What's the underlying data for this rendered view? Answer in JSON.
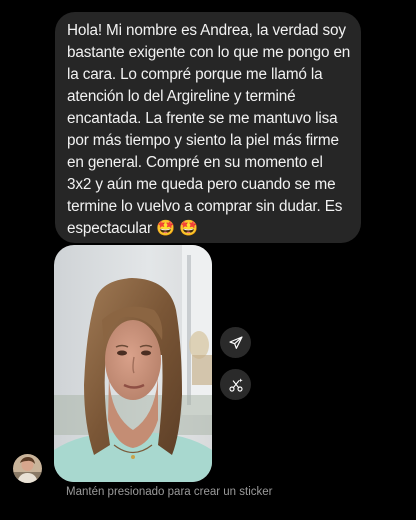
{
  "message": {
    "text": "Hola! Mi nombre es Andrea, la verdad soy bastante exigente con lo que me pongo en la cara. Lo compré porque me llamó la atención lo del Argireline y terminé encantada. La frente se me mantuvo lisa por más tiempo y siento la piel más firme en general. Compré en su momento el 3x2 y aún me queda pero cuando se me termine lo vuelvo a comprar sin dudar. Es espectacular 🤩 🤩"
  },
  "media": {
    "type": "photo",
    "icon_share": "paper-plane-icon",
    "icon_sticker": "scissors-sparkle-icon"
  },
  "sender": {
    "avatar_icon": "profile-photo"
  },
  "hint": {
    "text": "Mantén presionado para crear un sticker"
  },
  "colors": {
    "background": "#000000",
    "bubble": "#262626",
    "hint_text": "#9a9a9a",
    "button_bg": "#2a2a2a"
  }
}
